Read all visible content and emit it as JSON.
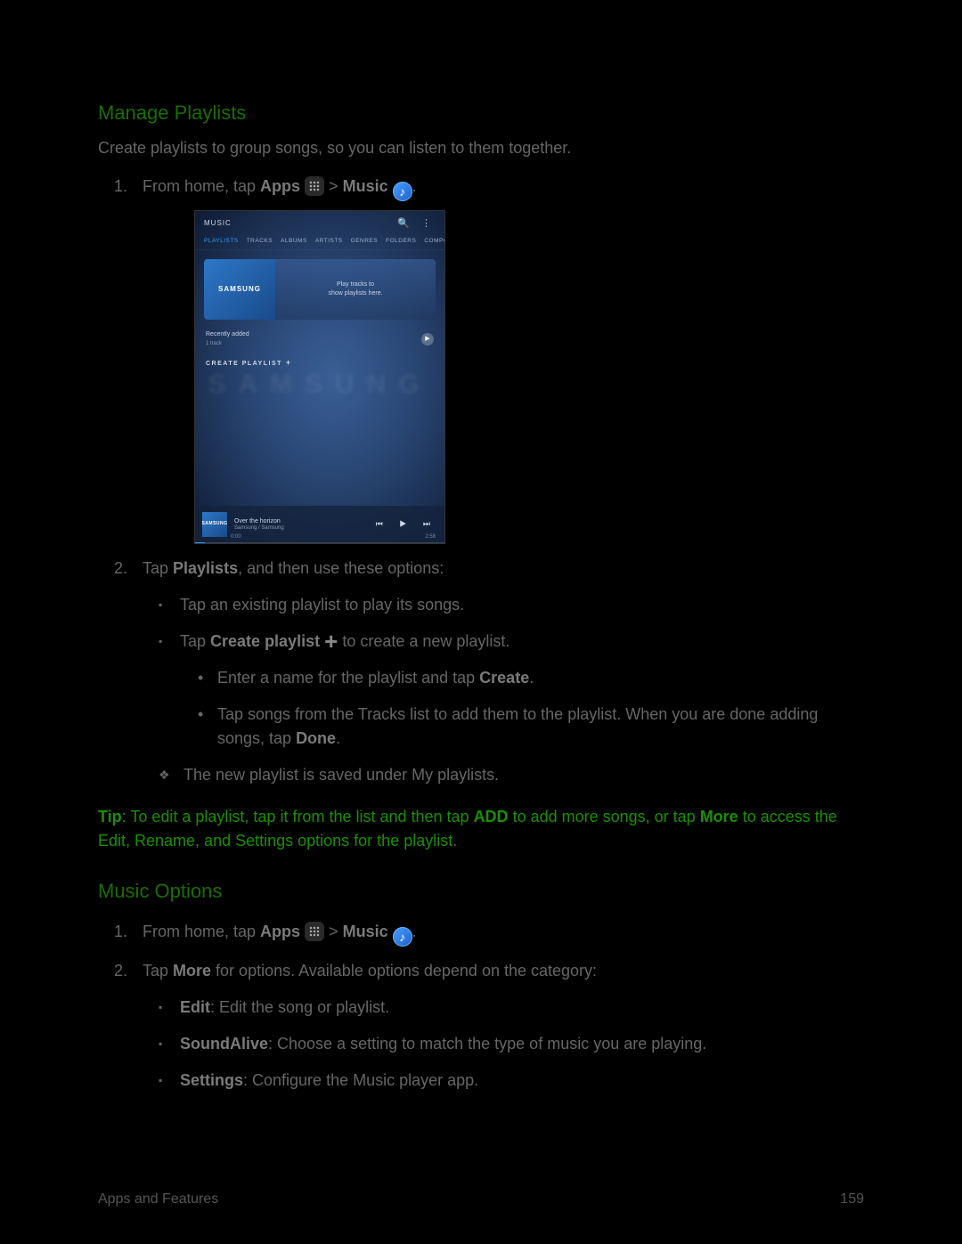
{
  "section1": {
    "title": "Manage Playlists",
    "intro": "Create playlists to group songs, so you can listen to them together.",
    "step1_a": "From home, tap ",
    "apps_label": "Apps",
    "gt": " > ",
    "music_label": "Music",
    "period": ".",
    "step2_a": "Tap ",
    "playlists_label": "Playlists",
    "step2_b": ", and then use these options:",
    "bullet_existing": "Tap an existing playlist to play its songs.",
    "bullet_create_a": "Tap ",
    "create_playlist_label": "Create playlist",
    "bullet_create_b": " to create a new playlist.",
    "sub_enter_a": "Enter a name for the playlist and tap ",
    "create_label": "Create",
    "sub_tap_a": "Tap songs from the Tracks list to add them to the playlist. When you are done adding songs, tap ",
    "done_label": "Done",
    "saved": "The new playlist is saved under My playlists.",
    "tip_label": "Tip",
    "tip_a": ": To edit a playlist, tap it from the list and then tap ",
    "tip_add": "ADD",
    "tip_b": " to add more songs, or tap ",
    "tip_more": "More",
    "tip_c": " to access the Edit, Rename, and Settings options for the playlist."
  },
  "section2": {
    "title": "Music Options",
    "step2_a": "Tap ",
    "more_label": "More",
    "step2_b": " for options. Available options depend on the category:",
    "edit_label": "Edit",
    "edit_desc": ": Edit the song or playlist.",
    "sa_label": "SoundAlive",
    "sa_desc": ": Choose a setting to match the type of music you are playing.",
    "settings_label": "Settings",
    "settings_desc": ": Configure the Music player app."
  },
  "screenshot": {
    "app_title": "MUSIC",
    "tabs": [
      "PLAYLISTS",
      "TRACKS",
      "ALBUMS",
      "ARTISTS",
      "GENRES",
      "FOLDERS",
      "COMPOSERS"
    ],
    "card_brand": "SAMSUNG",
    "card_msg1": "Play tracks to",
    "card_msg2": "show playlists here.",
    "recent_label": "Recently added",
    "recent_count": "1 track",
    "create_label": "CREATE PLAYLIST",
    "watermark": "SAMSUNG",
    "now_title": "Over the horizon",
    "now_sub": "Samsung / Samsung",
    "time_cur": "0:00",
    "time_total": "2:58"
  },
  "footer": {
    "left": "Apps and Features",
    "right": "159"
  }
}
